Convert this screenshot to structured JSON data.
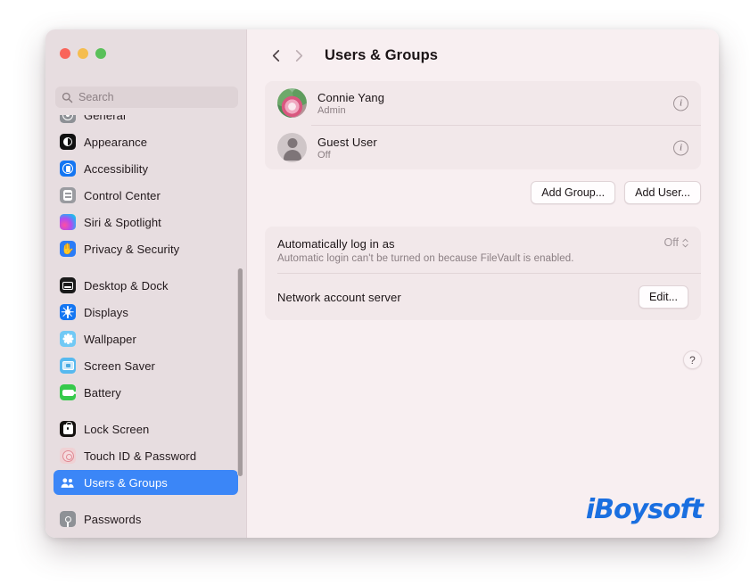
{
  "window": {
    "traffic_lights": [
      {
        "name": "close",
        "color": "#f9655b"
      },
      {
        "name": "minimize",
        "color": "#f5bd4f"
      },
      {
        "name": "zoom",
        "color": "#5ac05a"
      }
    ]
  },
  "search": {
    "placeholder": "Search",
    "value": "",
    "icon": "search-icon"
  },
  "sidebar": {
    "items": [
      {
        "label": "General",
        "icon": "gear-icon",
        "selected": false,
        "clipped": true
      },
      {
        "label": "Appearance",
        "icon": "appearance-icon",
        "selected": false
      },
      {
        "label": "Accessibility",
        "icon": "accessibility-icon",
        "selected": false
      },
      {
        "label": "Control Center",
        "icon": "control-center-icon",
        "selected": false
      },
      {
        "label": "Siri & Spotlight",
        "icon": "siri-icon",
        "selected": false
      },
      {
        "label": "Privacy & Security",
        "icon": "privacy-hand-icon",
        "selected": false
      },
      {
        "label": "Desktop & Dock",
        "icon": "desktop-dock-icon",
        "selected": false
      },
      {
        "label": "Displays",
        "icon": "displays-icon",
        "selected": false
      },
      {
        "label": "Wallpaper",
        "icon": "wallpaper-icon",
        "selected": false
      },
      {
        "label": "Screen Saver",
        "icon": "screen-saver-icon",
        "selected": false
      },
      {
        "label": "Battery",
        "icon": "battery-icon",
        "selected": false
      },
      {
        "label": "Lock Screen",
        "icon": "lock-screen-icon",
        "selected": false
      },
      {
        "label": "Touch ID & Password",
        "icon": "touch-id-icon",
        "selected": false
      },
      {
        "label": "Users & Groups",
        "icon": "users-groups-icon",
        "selected": true
      },
      {
        "label": "Passwords",
        "icon": "key-icon",
        "selected": false
      }
    ],
    "selection_color": "#3b86f7"
  },
  "header": {
    "title": "Users & Groups",
    "back_icon": "chevron-left-icon",
    "forward_icon": "chevron-right-icon",
    "forward_disabled": true
  },
  "users": [
    {
      "name": "Connie Yang",
      "role": "Admin",
      "avatar": "lotus-photo-avatar",
      "info_icon": "info-icon"
    },
    {
      "name": "Guest User",
      "role": "Off",
      "avatar": "generic-person-avatar",
      "info_icon": "info-icon"
    }
  ],
  "buttons": {
    "add_group": "Add Group...",
    "add_user": "Add User..."
  },
  "auto_login": {
    "title": "Automatically log in as",
    "description": "Automatic login can't be turned on because FileVault is enabled.",
    "value": "Off"
  },
  "network_account": {
    "title": "Network account server",
    "edit_label": "Edit..."
  },
  "help": {
    "label": "?"
  },
  "watermark": {
    "text": "iBoysoft",
    "color": "#1a6fe0"
  }
}
